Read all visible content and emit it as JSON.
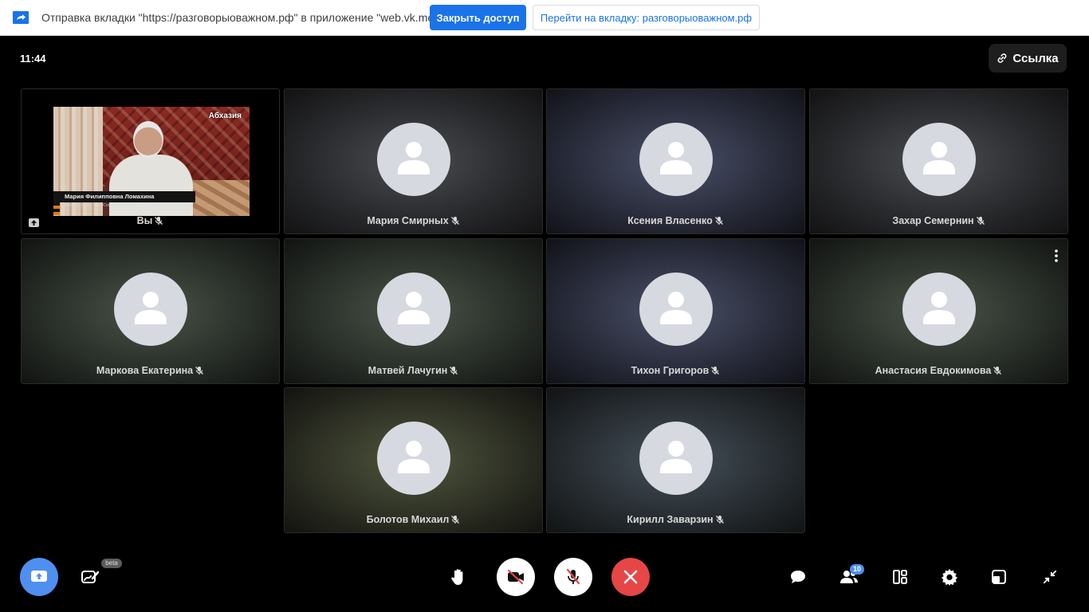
{
  "sharebar": {
    "message": "Отправка вкладки \"https://разговорыоважном.рф\" в приложение \"web.vk.me\"...",
    "stop_label": "Закрыть доступ",
    "goto_label": "Перейти на вкладку: разговорыоважном.рф"
  },
  "header": {
    "time": "11:44",
    "link_label": "Ссылка"
  },
  "self_tile": {
    "name": "Вы",
    "video_title": "Абхазия",
    "video_caption": "Мария Филипповна Ломахина",
    "video_subcaption": "ветеран труда, член Союза ветеранов"
  },
  "participants": [
    {
      "name": "Мария Смирных"
    },
    {
      "name": "Ксения Власенко"
    },
    {
      "name": "Захар Семернин"
    },
    {
      "name": "Маркова Екатерина"
    },
    {
      "name": "Матвей Лачугин"
    },
    {
      "name": "Тихон Григоров"
    },
    {
      "name": "Анастасия Евдокимова"
    },
    {
      "name": "Болотов Михаил"
    },
    {
      "name": "Кирилл Заварзин"
    }
  ],
  "toolbar": {
    "beta_label": "beta",
    "participants_count": "10"
  },
  "colors": {
    "accent": "#4f8ff0",
    "end_call": "#e64646",
    "share_blue": "#1a73e8"
  }
}
